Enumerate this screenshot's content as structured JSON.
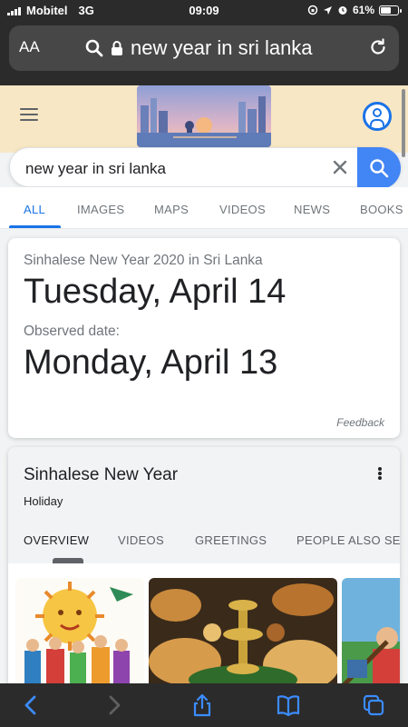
{
  "status": {
    "carrier": "Mobitel",
    "network": "3G",
    "time": "09:09",
    "battery": "61%",
    "battery_level": 0.61
  },
  "browser": {
    "text_size_label": "AA",
    "url": "new year in sri lanka"
  },
  "search": {
    "query": "new year in sri lanka"
  },
  "tabs": [
    "ALL",
    "IMAGES",
    "MAPS",
    "VIDEOS",
    "NEWS",
    "BOOKS"
  ],
  "answer": {
    "subtitle": "Sinhalese New Year 2020 in Sri Lanka",
    "date": "Tuesday, April 14",
    "observed_label": "Observed date:",
    "observed_date": "Monday, April 13",
    "feedback": "Feedback"
  },
  "knowledge": {
    "title": "Sinhalese New Year",
    "type": "Holiday",
    "tabs": [
      "OVERVIEW",
      "VIDEOS",
      "GREETINGS",
      "PEOPLE ALSO SE"
    ]
  },
  "colors": {
    "accent": "#1a73e8",
    "search_button": "#4285f4",
    "doodle_bg": "#f8e7c4"
  }
}
